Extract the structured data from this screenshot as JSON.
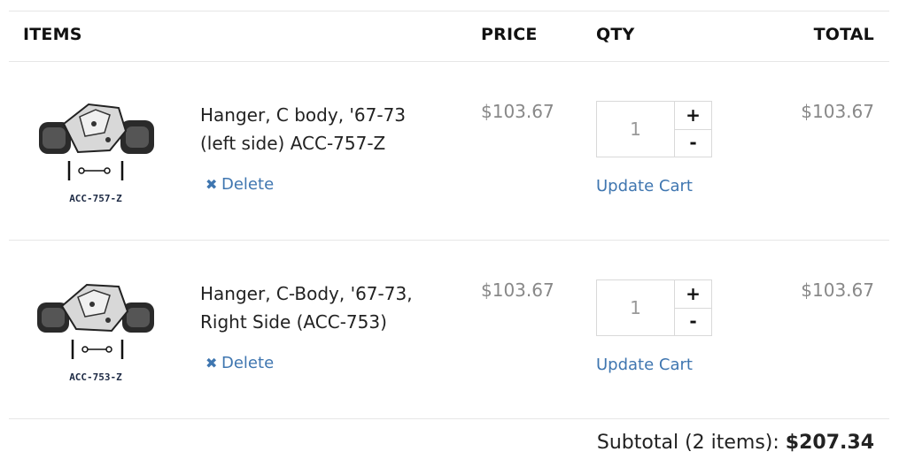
{
  "header": {
    "items": "ITEMS",
    "price": "PRICE",
    "qty": "QTY",
    "total": "TOTAL"
  },
  "rows": [
    {
      "name_line1": "Hanger, C body, '67-73",
      "name_line2": "(left side) ACC-757-Z",
      "thumb_label": "ACC-757-Z",
      "delete_label": "Delete",
      "price": "$103.67",
      "qty": "1",
      "plus": "+",
      "minus": "-",
      "update_label": "Update Cart",
      "total": "$103.67"
    },
    {
      "name_line1": "Hanger, C-Body, '67-73,",
      "name_line2": "Right Side (ACC-753)",
      "thumb_label": "ACC-753-Z",
      "delete_label": "Delete",
      "price": "$103.67",
      "qty": "1",
      "plus": "+",
      "minus": "-",
      "update_label": "Update Cart",
      "total": "$103.67"
    }
  ],
  "summary": {
    "label": "Subtotal (2 items):",
    "amount": "$207.34"
  },
  "icons": {
    "delete": "close-x-icon",
    "product": "exhaust-hanger-image"
  },
  "colors": {
    "link": "#3f76b0",
    "muted": "#888888",
    "text": "#222222",
    "divider": "#e6e6e6"
  }
}
